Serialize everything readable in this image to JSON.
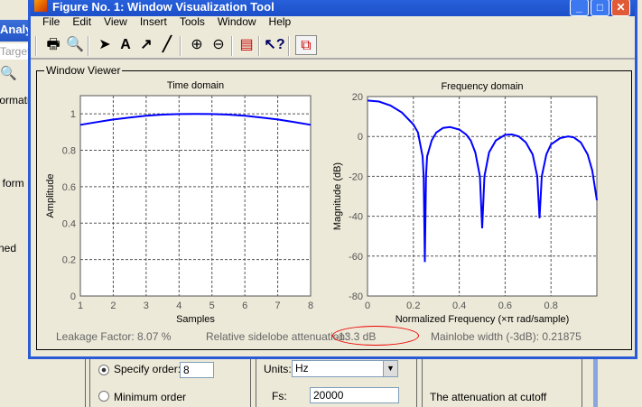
{
  "background_window": {
    "title": "Analy",
    "target_field": "Target",
    "texts": [
      "formati",
      "t form F",
      "ned"
    ]
  },
  "figure": {
    "title": "Figure No. 1: Window Visualization Tool",
    "menu": [
      "File",
      "Edit",
      "View",
      "Insert",
      "Tools",
      "Window",
      "Help"
    ],
    "toolbar": [
      "print-icon",
      "print-preview-icon",
      "select-arrow-icon",
      "text-icon",
      "arrow-icon",
      "line-icon",
      "zoom-in-icon",
      "zoom-out-icon",
      "legend-icon",
      "whats-this-help-icon",
      "window-compare-icon"
    ],
    "panel_title": "Window Viewer",
    "leakage": "Leakage Factor: 8.07 %",
    "sidelobe_label": "Relative sidelobe attenuation:",
    "sidelobe_value": "-13.3 dB",
    "mainlobe": "Mainlobe width (-3dB): 0.21875",
    "colors": {
      "line": "#0000ff",
      "annotation": "#ff0000"
    }
  },
  "chart_data": [
    {
      "type": "line",
      "title": "Time domain",
      "xlabel": "Samples",
      "ylabel": "Amplitude",
      "xlim": [
        1,
        8
      ],
      "ylim": [
        0,
        1.1
      ],
      "grid": true,
      "xticks": [
        "1",
        "2",
        "3",
        "4",
        "5",
        "6",
        "7",
        "8"
      ],
      "yticks": [
        "0",
        "0.2",
        "0.4",
        "0.6",
        "0.8",
        "1"
      ],
      "x": [
        1,
        1.5,
        2,
        2.5,
        3,
        3.5,
        4,
        4.5,
        5,
        5.5,
        6,
        6.5,
        7,
        7.5,
        8
      ],
      "y": [
        0.94,
        0.955,
        0.969,
        0.98,
        0.99,
        0.996,
        0.999,
        1.0,
        0.999,
        0.996,
        0.99,
        0.98,
        0.969,
        0.955,
        0.94
      ]
    },
    {
      "type": "line",
      "title": "Frequency domain",
      "xlabel": "Normalized Frequency  (×π rad/sample)",
      "ylabel": "Magnitude (dB)",
      "xlim": [
        0,
        1
      ],
      "ylim": [
        -80,
        20
      ],
      "grid": true,
      "xticks": [
        "0",
        "0.2",
        "0.4",
        "0.6",
        "0.8"
      ],
      "yticks": [
        "-80",
        "-60",
        "-40",
        "-20",
        "0",
        "20"
      ],
      "x": [
        0,
        0.05,
        0.1,
        0.15,
        0.2,
        0.22,
        0.24,
        0.245,
        0.25,
        0.255,
        0.26,
        0.28,
        0.3,
        0.33,
        0.36,
        0.4,
        0.43,
        0.45,
        0.47,
        0.49,
        0.5,
        0.51,
        0.53,
        0.56,
        0.6,
        0.63,
        0.66,
        0.69,
        0.72,
        0.74,
        0.75,
        0.76,
        0.78,
        0.8,
        0.84,
        0.875,
        0.9,
        0.93,
        0.96,
        0.98,
        1.0
      ],
      "y": [
        18,
        17.5,
        15.5,
        12,
        6,
        2,
        -10,
        -20,
        -63,
        -20,
        -10,
        -2,
        2,
        4.3,
        4.7,
        3.5,
        1,
        -2,
        -8,
        -20,
        -46,
        -20,
        -8,
        -2,
        0.8,
        1,
        0,
        -3,
        -9,
        -20,
        -41,
        -20,
        -9,
        -4,
        -0.8,
        0,
        -0.5,
        -3,
        -9,
        -17,
        -32
      ]
    }
  ],
  "dialog": {
    "specify_order": "Specify order:",
    "order_value": "8",
    "minimum_order": "Minimum order",
    "units_label": "Units:",
    "units_value": "Hz",
    "fs_label": "Fs:",
    "fs_value": "20000",
    "attenuation_text": "The attenuation at cutoff"
  }
}
